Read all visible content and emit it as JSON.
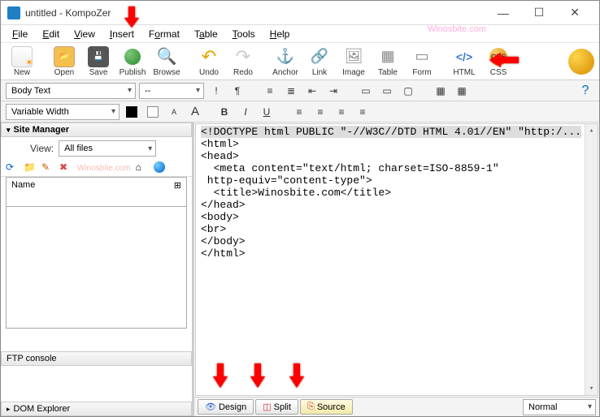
{
  "window": {
    "title": "untitled - KompoZer"
  },
  "watermark": "Winosbite.com",
  "menu": {
    "file": "File",
    "edit": "Edit",
    "view": "View",
    "insert": "Insert",
    "format": "Format",
    "table": "Table",
    "tools": "Tools",
    "help": "Help"
  },
  "toolbar": {
    "new": "New",
    "open": "Open",
    "save": "Save",
    "publish": "Publish",
    "browse": "Browse",
    "undo": "Undo",
    "redo": "Redo",
    "anchor": "Anchor",
    "link": "Link",
    "image": "Image",
    "table": "Table",
    "form": "Form",
    "html": "HTML",
    "css": "CSS"
  },
  "format": {
    "paragraph": "Body Text",
    "priority": "--",
    "font": "Variable Width"
  },
  "sitemgr": {
    "title": "Site Manager",
    "viewlabel": "View:",
    "viewval": "All files",
    "name": "Name",
    "ftp": "FTP console",
    "dom": "DOM Explorer"
  },
  "code": {
    "l1": "<!DOCTYPE html PUBLIC \"-//W3C//DTD HTML 4.01//EN\" \"http:/...",
    "l2": "<html>",
    "l3": "<head>",
    "l4": "  <meta content=\"text/html; charset=ISO-8859-1\"",
    "l5": " http-equiv=\"content-type\">",
    "l6": "  <title>Winosbite.com</title>",
    "l7": "</head>",
    "l8": "<body>",
    "l9": "<br>",
    "l10": "</body>",
    "l11": "</html>"
  },
  "tabs": {
    "design": "Design",
    "split": "Split",
    "source": "Source",
    "normal": "Normal"
  }
}
